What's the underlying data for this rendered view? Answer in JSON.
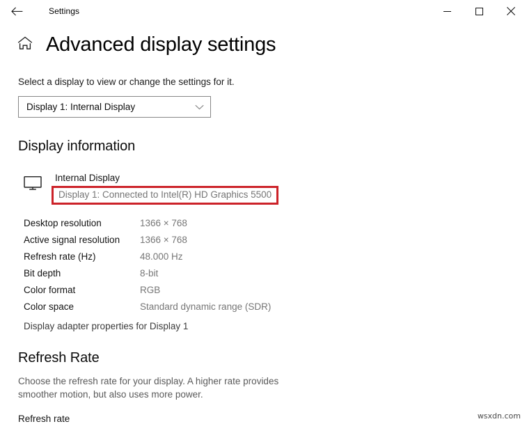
{
  "window": {
    "app_title": "Settings",
    "back_icon": "back-arrow-icon",
    "minimize_label": "Minimize",
    "maximize_label": "Maximize",
    "close_label": "Close"
  },
  "header": {
    "home_icon": "home-icon",
    "page_title": "Advanced display settings"
  },
  "main": {
    "intro_text": "Select a display to view or change the settings for it.",
    "display_select": {
      "value": "Display 1: Internal Display",
      "chevron_icon": "chevron-down-icon",
      "options": [
        "Display 1: Internal Display"
      ]
    },
    "display_information": {
      "heading": "Display information",
      "monitor_icon": "monitor-icon",
      "display_name": "Internal Display",
      "connection_text": "Display 1: Connected to Intel(R) HD Graphics 5500",
      "highlight_color": "#cc2229",
      "specs": [
        {
          "label": "Desktop resolution",
          "value": "1366 × 768"
        },
        {
          "label": "Active signal resolution",
          "value": "1366 × 768"
        },
        {
          "label": "Refresh rate (Hz)",
          "value": "48.000 Hz"
        },
        {
          "label": "Bit depth",
          "value": "8-bit"
        },
        {
          "label": "Color format",
          "value": "RGB"
        },
        {
          "label": "Color space",
          "value": "Standard dynamic range (SDR)"
        }
      ],
      "adapter_link": "Display adapter properties for Display 1"
    },
    "refresh_rate": {
      "heading": "Refresh Rate",
      "description": "Choose the refresh rate for your display. A higher rate provides smoother motion, but also uses more power.",
      "field_label": "Refresh rate"
    }
  },
  "watermark": "wsxdn.com"
}
